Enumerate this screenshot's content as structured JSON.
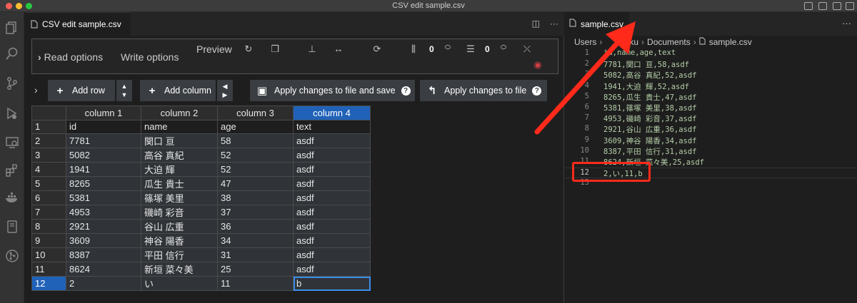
{
  "window": {
    "title": "CSV edit sample.csv"
  },
  "left_tab": {
    "label": "CSV edit sample.csv"
  },
  "options": {
    "read_label": "Read options",
    "write_label": "Write options",
    "preview_label": "Preview",
    "fixed_rows": "0",
    "fixed_cols": "0"
  },
  "toolbar": {
    "add_row": "Add row",
    "add_column": "Add column",
    "apply_save": "Apply changes to file and save",
    "apply": "Apply changes to file"
  },
  "grid": {
    "headers": [
      "column 1",
      "column 2",
      "column 3",
      "column 4"
    ],
    "rows": [
      {
        "n": "1",
        "c": [
          "id",
          "name",
          "age",
          "text"
        ]
      },
      {
        "n": "2",
        "c": [
          "7781",
          "関口 亘",
          "58",
          "asdf"
        ]
      },
      {
        "n": "3",
        "c": [
          "5082",
          "高谷 真紀",
          "52",
          "asdf"
        ]
      },
      {
        "n": "4",
        "c": [
          "1941",
          "大迫 輝",
          "52",
          "asdf"
        ]
      },
      {
        "n": "5",
        "c": [
          "8265",
          "瓜生 貴士",
          "47",
          "asdf"
        ]
      },
      {
        "n": "6",
        "c": [
          "5381",
          "篠塚 美里",
          "38",
          "asdf"
        ]
      },
      {
        "n": "7",
        "c": [
          "4953",
          "磯崎 彩音",
          "37",
          "asdf"
        ]
      },
      {
        "n": "8",
        "c": [
          "2921",
          "谷山 広重",
          "36",
          "asdf"
        ]
      },
      {
        "n": "9",
        "c": [
          "3609",
          "神谷 陽香",
          "34",
          "asdf"
        ]
      },
      {
        "n": "10",
        "c": [
          "8387",
          "平田 信行",
          "31",
          "asdf"
        ]
      },
      {
        "n": "11",
        "c": [
          "8624",
          "新垣 菜々美",
          "25",
          "asdf"
        ]
      },
      {
        "n": "12",
        "c": [
          "2",
          "い",
          "11",
          "b"
        ]
      }
    ]
  },
  "right_tab": {
    "label": "sample.csv"
  },
  "breadcrumb": {
    "a": "Users",
    "b": "taku",
    "c": "Documents",
    "d": "sample.csv"
  },
  "editor": {
    "lines": [
      {
        "n": "1",
        "t": "id,name,age,text"
      },
      {
        "n": "2",
        "t": "7781,関口 亘,58,asdf"
      },
      {
        "n": "3",
        "t": "5082,高谷 真紀,52,asdf"
      },
      {
        "n": "4",
        "t": "1941,大迫 輝,52,asdf"
      },
      {
        "n": "5",
        "t": "8265,瓜生 貴士,47,asdf"
      },
      {
        "n": "6",
        "t": "5381,篠塚 美里,38,asdf"
      },
      {
        "n": "7",
        "t": "4953,磯崎 彩音,37,asdf"
      },
      {
        "n": "8",
        "t": "2921,谷山 広重,36,asdf"
      },
      {
        "n": "9",
        "t": "3609,神谷 陽香,34,asdf"
      },
      {
        "n": "10",
        "t": "8387,平田 信行,31,asdf"
      },
      {
        "n": "11",
        "t": "8624,新垣 菜々美,25,asdf"
      },
      {
        "n": "12",
        "t": "2,い,11,b"
      },
      {
        "n": "13",
        "t": ""
      }
    ]
  },
  "colors": {
    "accent": "#2062b8",
    "annotation": "#ff2a1a"
  }
}
